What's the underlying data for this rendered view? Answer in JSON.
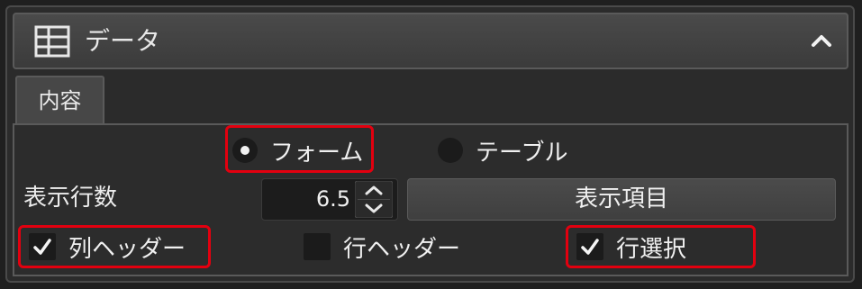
{
  "panel": {
    "title": "データ",
    "icon": "table-icon",
    "collapse_icon": "chevron-up-icon"
  },
  "tabs": [
    {
      "label": "内容",
      "active": true
    }
  ],
  "display_mode": {
    "options": [
      {
        "label": "フォーム",
        "selected": true
      },
      {
        "label": "テーブル",
        "selected": false
      }
    ]
  },
  "rows": {
    "label": "表示行数",
    "value": "6.5",
    "items_button": "表示項目"
  },
  "options": {
    "column_header": {
      "label": "列ヘッダー",
      "checked": true
    },
    "row_header": {
      "label": "行ヘッダー",
      "checked": false
    },
    "row_select": {
      "label": "行選択",
      "checked": true
    }
  },
  "colors": {
    "highlight": "#e3000f",
    "panel_bg": "#2b2b2b",
    "header_bg": "#444444"
  }
}
